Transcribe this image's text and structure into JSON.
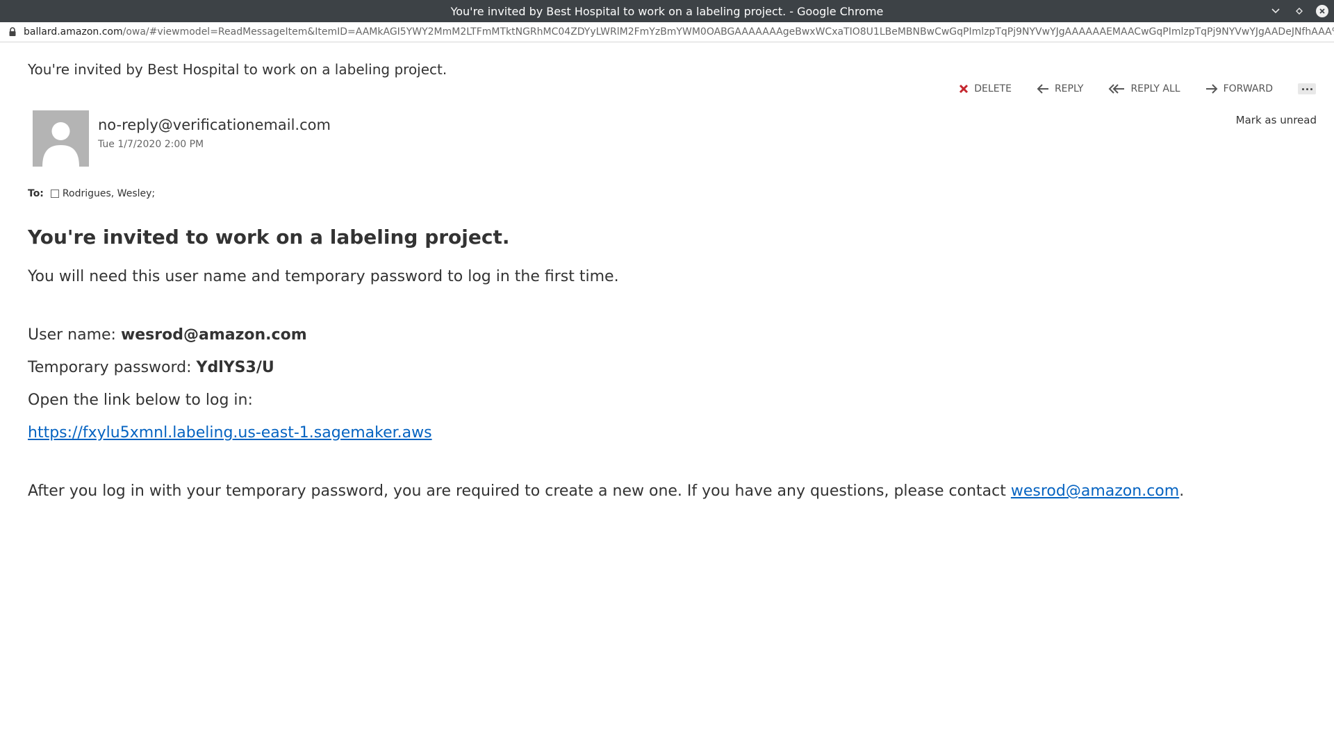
{
  "window": {
    "title": "You're invited by Best Hospital to work on a labeling project. - Google Chrome"
  },
  "address": {
    "host": "ballard.amazon.com",
    "path": "/owa/#viewmodel=ReadMessageItem&ItemID=AAMkAGI5YWY2MmM2LTFmMTktNGRhMC04ZDYyLWRlM2FmYzBmYWM0OABGAAAAAAAgeBwxWCxaTIO8U1LBeMBNBwCwGqPImlzpTqPj9NYVwYJgAAAAAAEMAACwGqPImlzpTqPj9NYVwYJgAADeJNfhAAA%3D&wid=39&isp..."
  },
  "message": {
    "subject": "You're invited by Best Hospital to work on a labeling project.",
    "sender": "no-reply@verificationemail.com",
    "date": "Tue 1/7/2020 2:00 PM",
    "to_label": "To:",
    "recipient": "Rodrigues, Wesley;"
  },
  "toolbar": {
    "delete": "DELETE",
    "reply": "REPLY",
    "reply_all": "REPLY ALL",
    "forward": "FORWARD",
    "mark_unread": "Mark as unread"
  },
  "body": {
    "heading": "You're invited to work on a labeling project.",
    "intro": "You will need this user name and temporary password to log in the first time.",
    "username_label": "User name: ",
    "username": "wesrod@amazon.com",
    "password_label": "Temporary password: ",
    "password": "YdlYS3/U",
    "open_link_text": "Open the link below to log in:",
    "link": "https://fxylu5xmnl.labeling.us-east-1.sagemaker.aws",
    "after_text": "After you log in with your temporary password, you are required to create a new one. If you have any questions, please contact ",
    "contact_email": "wesrod@amazon.com",
    "after_end": "."
  },
  "icons": {
    "lock": "lock-icon",
    "delete": "x-icon",
    "reply": "arrow-left-icon",
    "reply_all": "double-arrow-left-icon",
    "forward": "arrow-right-icon",
    "more": "more-icon",
    "avatar": "person-icon"
  },
  "colors": {
    "titlebar": "#3d4246",
    "delete_icon": "#c4262e",
    "link": "#0563c1"
  }
}
